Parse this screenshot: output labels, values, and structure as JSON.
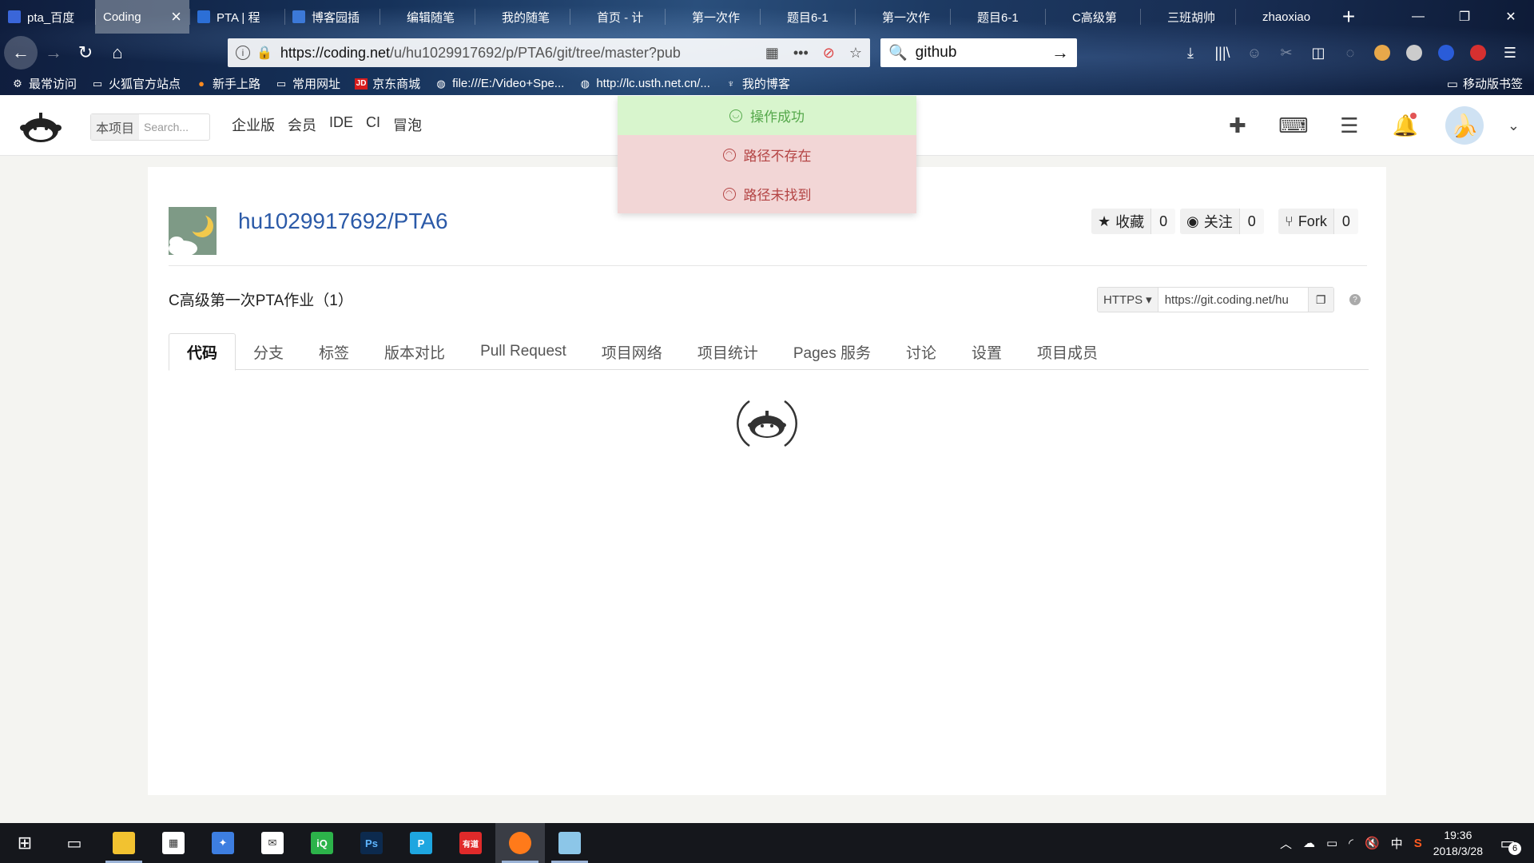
{
  "browser": {
    "tabs": [
      {
        "label": "pta_百度",
        "active": false
      },
      {
        "label": "Coding",
        "active": true
      },
      {
        "label": "PTA | 程",
        "active": false
      },
      {
        "label": "博客园插",
        "active": false
      },
      {
        "label": "编辑随笔",
        "active": false
      },
      {
        "label": "我的随笔",
        "active": false
      },
      {
        "label": "首页 - 计",
        "active": false
      },
      {
        "label": "第一次作",
        "active": false
      },
      {
        "label": "题目6-1",
        "active": false
      },
      {
        "label": "第一次作",
        "active": false
      },
      {
        "label": "题目6-1",
        "active": false
      },
      {
        "label": "C高级第",
        "active": false
      },
      {
        "label": "三班胡帅",
        "active": false
      },
      {
        "label": "zhaoxiao",
        "active": false
      }
    ],
    "url_prefix": "https://coding.net",
    "url_rest": "/u/hu1029917692/p/PTA6/git/tree/master?pub",
    "search_value": "github",
    "bookmarks": [
      {
        "label": "最常访问",
        "icon": "gear-icon"
      },
      {
        "label": "火狐官方站点",
        "icon": "folder-icon"
      },
      {
        "label": "新手上路",
        "icon": "firefox-icon"
      },
      {
        "label": "常用网址",
        "icon": "folder-icon"
      },
      {
        "label": "京东商城",
        "icon": "jd-icon"
      },
      {
        "label": "file:///E:/Video+Spe...",
        "icon": "globe-icon"
      },
      {
        "label": "http://lc.usth.net.cn/...",
        "icon": "globe-icon"
      },
      {
        "label": "我的博客",
        "icon": "blog-icon"
      }
    ],
    "mobile_bookmarks": "移动版书签"
  },
  "header": {
    "search_scope": "本项目",
    "search_placeholder": "Search...",
    "links": [
      "企业版",
      "会员",
      "IDE",
      "CI",
      "冒泡"
    ]
  },
  "toasts": {
    "success": "操作成功",
    "error1": "路径不存在",
    "error2": "路径未找到"
  },
  "project": {
    "title": "hu1029917692/PTA6",
    "description": "C高级第一次PTA作业（1）",
    "star_label": "收藏",
    "star_count": "0",
    "watch_label": "关注",
    "watch_count": "0",
    "fork_label": "Fork",
    "fork_count": "0",
    "clone_protocol": "HTTPS",
    "clone_url": "https://git.coding.net/hu",
    "tabs": [
      "代码",
      "分支",
      "标签",
      "版本对比",
      "Pull Request",
      "项目网络",
      "项目统计",
      "Pages 服务",
      "讨论",
      "设置",
      "项目成员"
    ]
  },
  "taskbar": {
    "time": "19:36",
    "date": "2018/3/28",
    "ime": "中",
    "notification_count": "6"
  }
}
